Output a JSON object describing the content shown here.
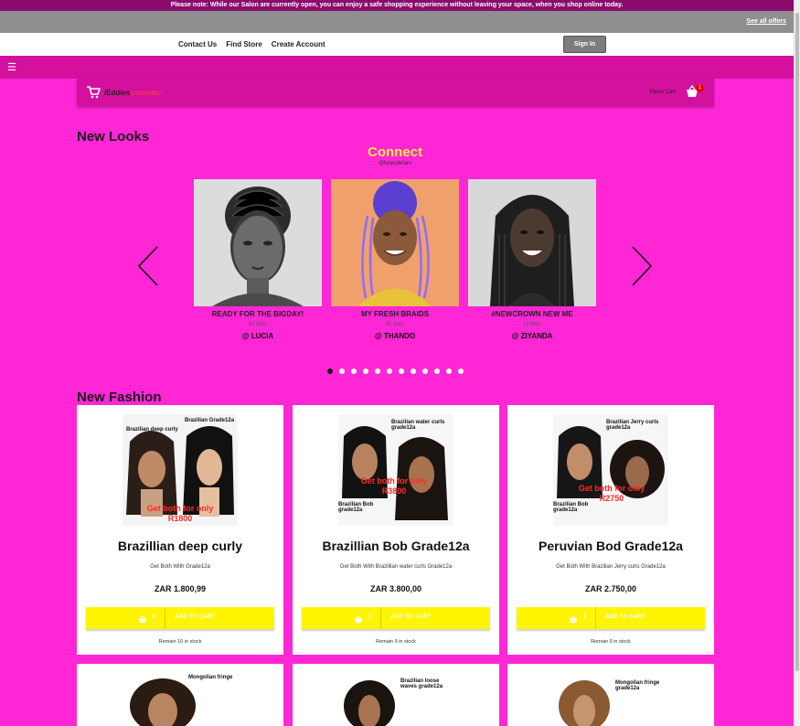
{
  "notice": "Please note: While our Salon are currently open, you can enjoy a safe shopping experience without leaving your space, when you shop online today.",
  "offers": {
    "see_all": "See all offers"
  },
  "nav": {
    "links": [
      "Contact Us",
      "Find Store",
      "Create Account"
    ],
    "signin": "Sign In"
  },
  "menu_icon": "hamburger-icon",
  "brand": {
    "name": "/Eddies",
    "suffix": "cosmetic/",
    "menu_cart": "Menu Cart",
    "cart_count": "1"
  },
  "looks": {
    "title": "New Looks",
    "connect": "Connect",
    "handle": "@lwandlelam",
    "items": [
      {
        "caption": "READY FOR THE BIGDAY!",
        "likes": "65 likes",
        "user": "@ LUCIA"
      },
      {
        "caption": "MY FRESH BRAIDS",
        "likes": "45 likes",
        "user": "@ THANDO"
      },
      {
        "caption": "#NEWCROWN NEW ME",
        "likes": "13 likes",
        "user": "@ ZIYANDA"
      }
    ],
    "slide_count": 12,
    "active_slide": 0
  },
  "fashion": {
    "title": "New Fashion",
    "products": [
      {
        "name": "Brazillian deep curly",
        "desc": "Get Both With Grade12a",
        "price": "ZAR 1.800,99",
        "qty": "0",
        "add": "ADD TO CART",
        "stock": "Remain 10 in stock",
        "img_label_1": "Brazilian deep curly",
        "img_label_2": "Brazilian Grade12a",
        "promo": "Get both for only",
        "promo_price": "R1800"
      },
      {
        "name": "Brazillian Bob Grade12a",
        "desc": "Get Both With Brazillian water curls Grade12a",
        "price": "ZAR 3.800,00",
        "qty": "1",
        "add": "ADD TO CART",
        "stock": "Remain 9 in stock",
        "img_label_1": "Brazilian water curls grade12a",
        "img_label_2": "Brazilian Bob grade12a",
        "promo": "Get both for only",
        "promo_price": "R3800"
      },
      {
        "name": "Peruvian Bod Grade12a",
        "desc": "Get Both With Brazilian Jerry curls Grade12a",
        "price": "ZAR 2.750,00",
        "qty": "1",
        "add": "ADD TO CART",
        "stock": "Remain 9 in stock",
        "img_label_1": "Brazilian Jerry curls grade12a",
        "img_label_2": "Brazilian Bob grade12a",
        "promo": "Get both for only",
        "promo_price": "R2750"
      }
    ],
    "next_row_labels": [
      "Mongolian fringe",
      "Brazilian loose waves grade12a",
      "Mongolian fringe grade12a"
    ]
  },
  "colors": {
    "page": "#ff26d6",
    "bar": "#d3119e",
    "accent_yellow": "#fff500",
    "connect": "#fff13b"
  }
}
